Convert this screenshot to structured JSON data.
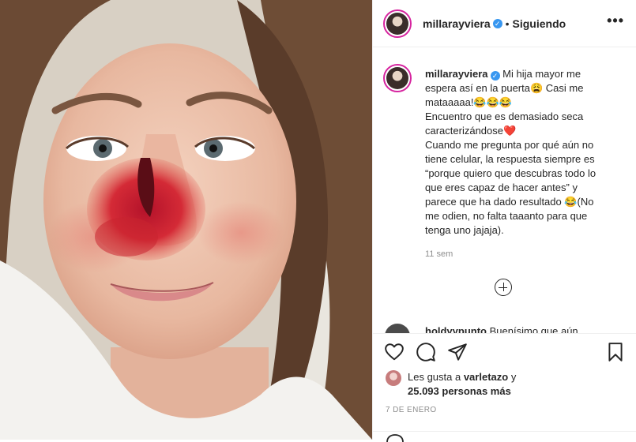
{
  "post": {
    "username": "millarayviera",
    "follow_label": "Siguiendo",
    "caption_lines": [
      "Mi hija mayor me",
      "espera así en la puerta😩 Casi me",
      "mataaaaa!😂😂😂",
      "Encuentro que es demasiado seca",
      "caracterizándose❤️",
      "Cuando me pregunta por qué aún no",
      "tiene celular, la respuesta siempre es",
      "“porque quiero que descubras todo lo",
      "que eres capaz de hacer antes” y",
      "parece que ha dado resultado 😂(No",
      "me odien, no falta taaanto para que",
      "tenga uno jajaja)."
    ],
    "time_ago": "11 sem",
    "comment_user": "holdyypunto",
    "comment_text": "Buenísimo que aún",
    "likes_prefix": "Les gusta a ",
    "likes_user": "varletazo",
    "likes_suffix": " y",
    "likes_others": "25.093 personas más",
    "date": "7 DE ENERO"
  },
  "icons": {
    "verified": "verified-badge-icon",
    "more": "more-options-icon",
    "add": "add-comment-plus-icon",
    "like": "heart-icon",
    "comment": "comment-bubble-icon",
    "share": "paper-plane-icon",
    "save": "bookmark-icon"
  },
  "colors": {
    "story_ring": "#d6249f",
    "verified": "#3897f0",
    "muted_text": "#8e8e8e",
    "border": "#efefef"
  }
}
